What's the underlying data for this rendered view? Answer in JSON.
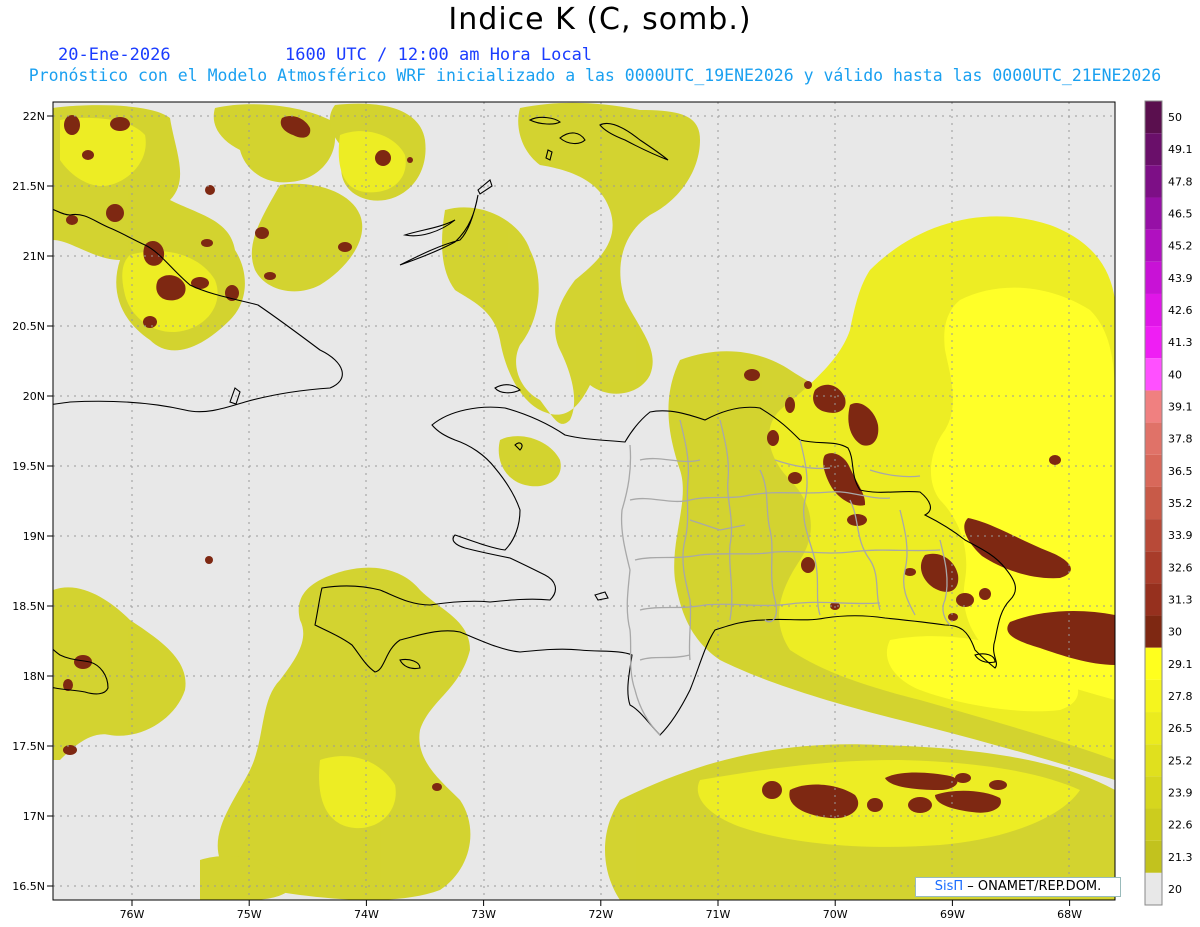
{
  "title": "Indice K (C, somb.)",
  "date": "20-Ene-2026",
  "time": "1600 UTC / 12:00 am Hora Local",
  "subtitle": "Pronóstico con el Modelo Atmosférico WRF inicializado a las 0000UTC_19ENE2026 y válido hasta las  0000UTC_21ENE2026",
  "credit": {
    "brand": "SisΠ",
    "org": " – ONAMET/REP.DOM."
  },
  "lat_labels": [
    "22N",
    "21.5N",
    "21N",
    "20.5N",
    "20N",
    "19.5N",
    "19N",
    "18.5N",
    "18N",
    "17.5N",
    "17N",
    "16.5N"
  ],
  "lon_labels": [
    "76W",
    "75W",
    "74W",
    "73W",
    "72W",
    "71W",
    "70W",
    "69W",
    "68W"
  ],
  "colorbar": {
    "values": [
      "50",
      "49.1",
      "47.8",
      "46.5",
      "45.2",
      "43.9",
      "42.6",
      "41.3",
      "40",
      "39.1",
      "37.8",
      "36.5",
      "35.2",
      "33.9",
      "32.6",
      "31.3",
      "30",
      "29.1",
      "27.8",
      "26.5",
      "25.2",
      "23.9",
      "22.6",
      "21.3",
      "20"
    ],
    "colors": [
      "#5a0f4e",
      "#6a0f6a",
      "#7d0f86",
      "#9610a6",
      "#b010c0",
      "#c812d6",
      "#e016e8",
      "#ef1ef4",
      "#ff50ff",
      "#f08080",
      "#e07268",
      "#d8685a",
      "#c85a48",
      "#b84a38",
      "#a83c2a",
      "#96301e",
      "#7e2812",
      "#ffff1e",
      "#f5f51e",
      "#ebeb1e",
      "#e0e01e",
      "#d6d61e",
      "#cccc1e",
      "#c2c21e",
      "#e8e8e8"
    ]
  },
  "colors": {
    "background": "#e8e8e8",
    "k_low": "#d2d226",
    "k_mid": "#eded24",
    "k_high": "#ffff28",
    "k_extreme": "#7e2812"
  }
}
